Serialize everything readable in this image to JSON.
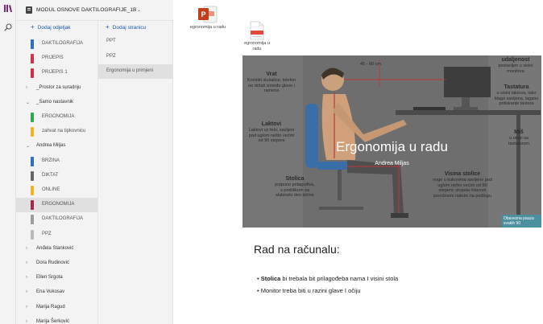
{
  "header": {
    "notebook_title": "MODUL OSNOVE DAKTILOGRAFIJE_1B"
  },
  "sections_pane": {
    "add_label": "Dodaj odjeljak",
    "items": [
      {
        "kind": "section",
        "label": "DAKTILOGRAFIJA",
        "color": "#2e6fb7",
        "selected": false
      },
      {
        "kind": "section",
        "label": "PRIJEPIS",
        "color": "#d32f4a",
        "selected": false
      },
      {
        "kind": "section",
        "label": "PRIJEPIS 1",
        "color": "#d32f4a",
        "selected": false
      },
      {
        "kind": "group",
        "label": "_Prostor za suradnju",
        "arrow": ">"
      },
      {
        "kind": "group",
        "label": "_Samo nastavnik",
        "arrow": "v"
      },
      {
        "kind": "section",
        "label": "ERGONOMIJA",
        "color": "#2fa84f",
        "selected": false
      },
      {
        "kind": "section",
        "label": "zahvat na tipkovnicu",
        "color": "#f0b323",
        "selected": false
      },
      {
        "kind": "group",
        "label": "Andrea Miljas",
        "arrow": "v"
      },
      {
        "kind": "section",
        "label": "BRZINA",
        "color": "#2e6fb7",
        "selected": false
      },
      {
        "kind": "section",
        "label": "DIKTAT",
        "color": "#666666",
        "selected": false
      },
      {
        "kind": "section",
        "label": "ONLINE",
        "color": "#f0b323",
        "selected": false
      },
      {
        "kind": "section",
        "label": "ERGONOMIJA",
        "color": "#a8254a",
        "selected": true
      },
      {
        "kind": "section",
        "label": "DAKTILOGRAFIJA",
        "color": "#9c9c9c",
        "selected": false
      },
      {
        "kind": "section",
        "label": "PPZ",
        "color": "#bbbbbb",
        "selected": false
      },
      {
        "kind": "group",
        "label": "Anđela Stanković",
        "arrow": ">"
      },
      {
        "kind": "group",
        "label": "Dora Rudinović",
        "arrow": ">"
      },
      {
        "kind": "group",
        "label": "Ellen Srgota",
        "arrow": ">"
      },
      {
        "kind": "group",
        "label": "Ena Vukosav",
        "arrow": ">"
      },
      {
        "kind": "group",
        "label": "Marija Ragud",
        "arrow": ">"
      },
      {
        "kind": "group",
        "label": "Marija Šerković",
        "arrow": ">"
      }
    ]
  },
  "pages_pane": {
    "add_label": "Dodaj stranicu",
    "items": [
      {
        "label": "PPT",
        "selected": false
      },
      {
        "label": "PPZ",
        "selected": false
      },
      {
        "label": "Ergonomija u primjeni",
        "selected": true
      }
    ]
  },
  "attachments": {
    "ppt_label": "egronomija u radu",
    "pdf_label": "egronomija u radu"
  },
  "slide": {
    "title": "Ergonomija u radu",
    "subtitle": "Andrea Miljas",
    "dimension": "45 - 60 cm",
    "top_right_partial": "udaljenost",
    "top_right_text": "postavljen u visini monitora",
    "vrat_title": "Vrat",
    "vrat_text": "Koristiti slušalice; telefon ne držati između glave i ramena",
    "tastatura_title": "Tastatura",
    "tastatura_text": "u visini laktova, lako blago savijena, lagano pritiskanje tastera",
    "laktovi_title": "Laktovi",
    "laktovi_text": "Laktovi uz telo, savijeni pod uglom nešto većim od 90 stepeni",
    "mis_title": "Miš",
    "mis_text": "u ravni sa tastaturom",
    "stolica_title": "Stolica",
    "stolica_text": "potpuno prilagođiva, s podrškom za slabinski deo kičme",
    "visina_title": "Visina stolice",
    "visina_text": "noge u kukovima savijene pod uglom nešto većim od 90 stepeni; stopala čitavom površinom naleže na podlogu",
    "note_text": "Obavezna pauza svakih 90"
  },
  "content": {
    "heading": "Rad na računalu:",
    "bullet1_bold": "Stolica",
    "bullet1_rest": " bi trebala bit  prilagođeba nama I visini stola",
    "bullet2": "Monitor treba biti u  razini glave I očiju"
  }
}
